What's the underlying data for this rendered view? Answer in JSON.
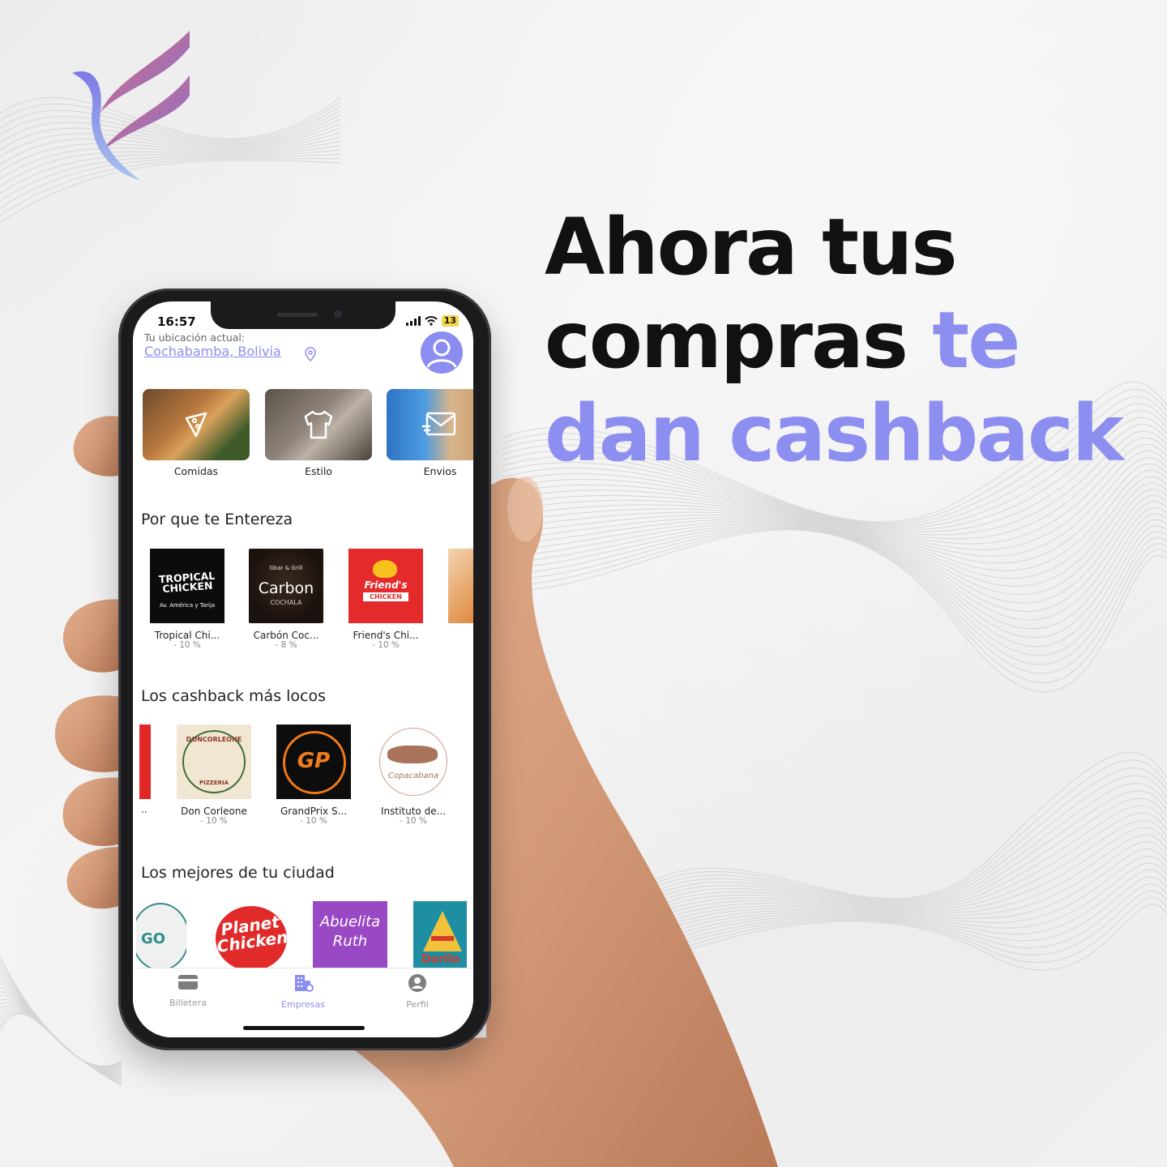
{
  "headline": {
    "line1": "Ahora tus",
    "line2_plain": "compras ",
    "line2_accent": "te",
    "line3_accent": "dan cashback"
  },
  "colors": {
    "accent": "#8d8ff0",
    "text": "#111111"
  },
  "phone": {
    "status": {
      "time": "16:57",
      "battery": "13"
    },
    "location": {
      "label": "Tu ubicación actual:",
      "value": "Cochabamba, Bolivia"
    },
    "categories": [
      {
        "label": "Comidas",
        "icon": "pizza-icon"
      },
      {
        "label": "Estilo",
        "icon": "shirt-icon"
      },
      {
        "label": "Envios",
        "icon": "mail-icon"
      }
    ],
    "sections": {
      "interest": {
        "title": "Por que te Entereza",
        "items": [
          {
            "name": "Tropical Chi...",
            "pct": "- 10 %",
            "logo_line1": "TROPICAL",
            "logo_line2": "CHICKEN",
            "logo_line3": "Av. América y Tarija"
          },
          {
            "name": "Carbón Coc...",
            "pct": "- 8 %",
            "logo_line1": "Gbar & Grill",
            "logo_line2": "Carbon",
            "logo_line3": "COCHALA"
          },
          {
            "name": "Friend's Chi...",
            "pct": "- 10 %",
            "logo_line1": "Friend's",
            "logo_line2": "CHICKEN"
          }
        ]
      },
      "crazy": {
        "title": "Los cashback más locos",
        "items": [
          {
            "name": "Don Corleone",
            "pct": "- 10 %",
            "logo_line1": "DONCORLEONE",
            "logo_line2": "PIZZERIA"
          },
          {
            "name": "GrandPrix S...",
            "pct": "- 10 %",
            "logo_line1": "GP"
          },
          {
            "name": "Instituto de...",
            "pct": "- 10 %",
            "logo_line1": "Copacabana"
          }
        ]
      },
      "best": {
        "title": "Los mejores de tu ciudad",
        "items": [
          {
            "logo_line1": "GO"
          },
          {
            "logo_line1": "Planet",
            "logo_line2": "Chicken"
          },
          {
            "logo_line1": "Abuelita",
            "logo_line2": "Ruth"
          },
          {
            "logo_line1": "Dorilo"
          }
        ]
      }
    },
    "tabs": [
      {
        "label": "Billetera",
        "icon": "wallet-icon"
      },
      {
        "label": "Empresas",
        "icon": "buildings-icon",
        "active": true
      },
      {
        "label": "Perfil",
        "icon": "profile-icon"
      }
    ]
  }
}
